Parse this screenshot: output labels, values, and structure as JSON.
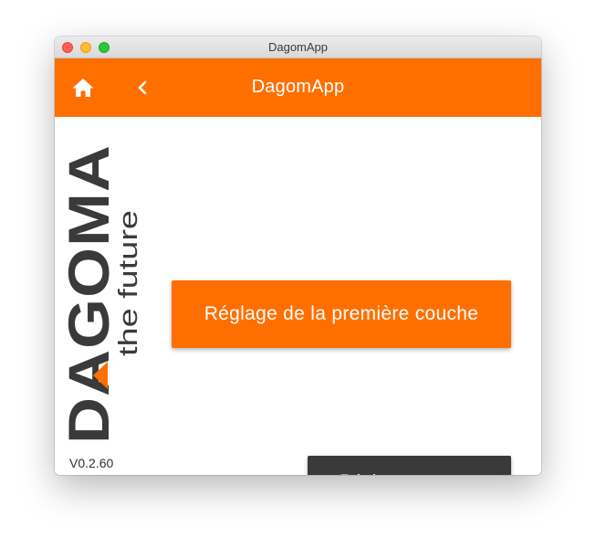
{
  "window": {
    "title": "DagomApp"
  },
  "appbar": {
    "title": "DagomApp",
    "home_icon": "home-icon",
    "back_icon": "chevron-left-icon",
    "color": "#ff6f00"
  },
  "logo": {
    "brand": "DAGOMA",
    "tagline": "the future",
    "accent_color": "#ff6f00",
    "text_color": "#3a3a3a"
  },
  "main": {
    "primary_button": "Réglage de la première couche",
    "secondary_button": "Réglages experts",
    "primary_color": "#ff6f00",
    "secondary_color": "#3a3a3a"
  },
  "footer": {
    "version": "V0.2.60"
  }
}
